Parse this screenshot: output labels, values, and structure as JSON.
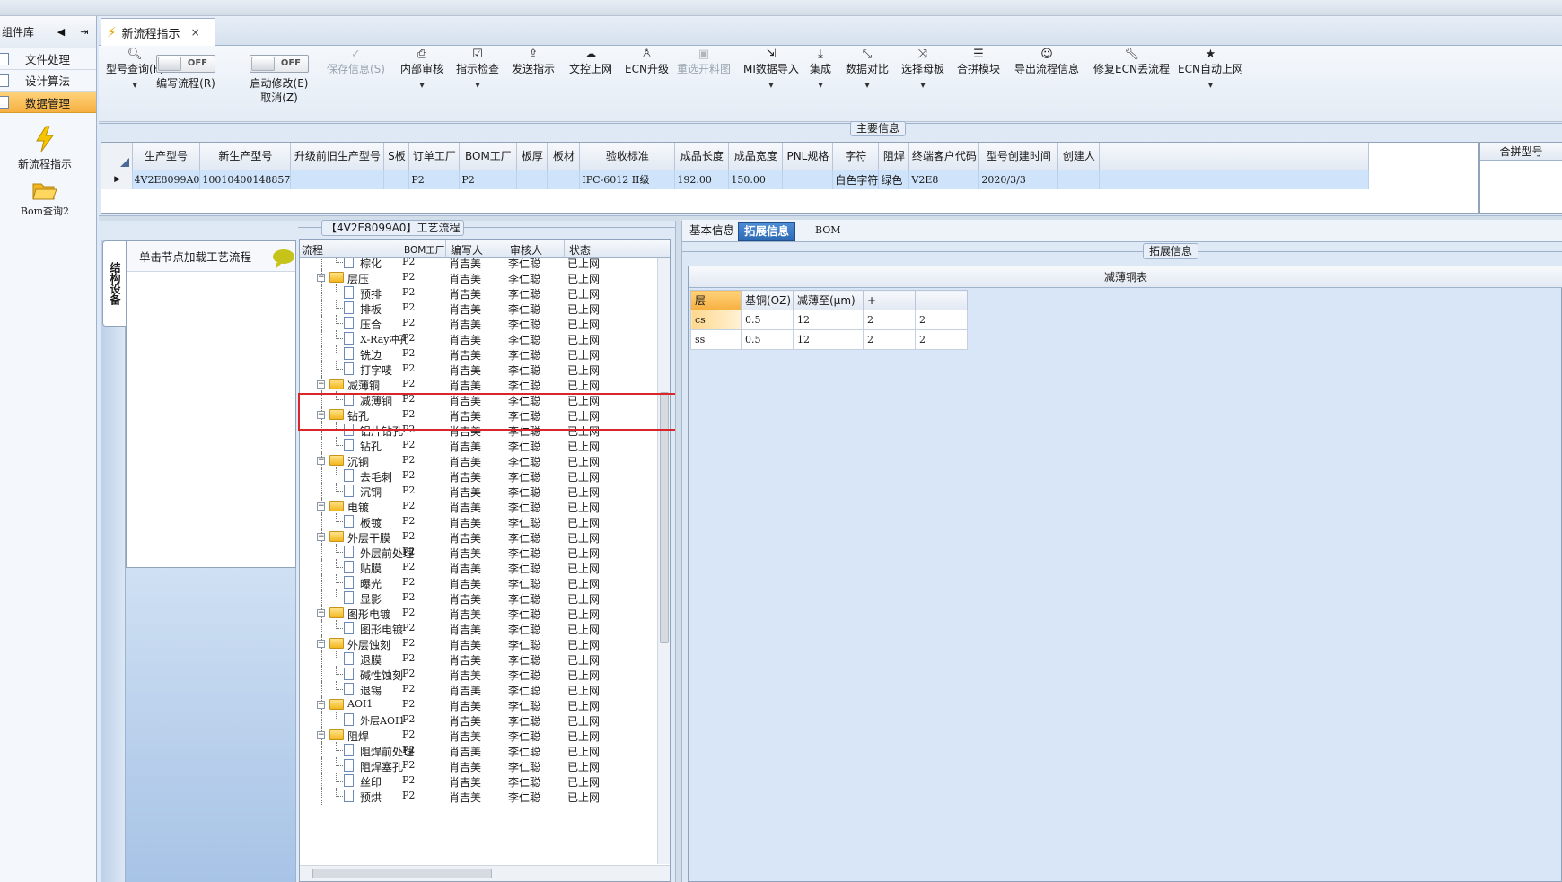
{
  "left_panel": {
    "title": "组件库",
    "items": [
      {
        "label": "文件处理",
        "active": false
      },
      {
        "label": "设计算法",
        "active": false
      },
      {
        "label": "数据管理",
        "active": true
      }
    ],
    "tools": [
      {
        "label": "新流程指示",
        "icon": "lightning-icon"
      },
      {
        "label": "Bom查询2",
        "icon": "folder-open-icon"
      }
    ]
  },
  "doc_tab": {
    "label": "新流程指示",
    "close": "×"
  },
  "toolbar": {
    "query": "型号查询(F)",
    "edit_flow": "编写流程(R)",
    "edit_flow_toggle": "OFF",
    "start_edit": "启动修改(E)",
    "cancel": "取消(Z)",
    "start_edit_toggle": "OFF",
    "save": "保存信息(S)",
    "internal_review": "内部审核",
    "check": "指示检查",
    "send": "发送指示",
    "upload": "文控上网",
    "ecn_upgrade": "ECN升级",
    "reselect_chart": "重选开料图",
    "mi_import": "MI数据导入",
    "integrate": "集成",
    "compare": "数据对比",
    "select_mother": "选择母板",
    "merge_module": "合拼模块",
    "export_flow": "导出流程信息",
    "repair_ecn": "修复ECN丢流程",
    "ecn_auto": "ECN自动上网"
  },
  "main_info": {
    "caption": "主要信息",
    "columns": [
      "生产型号",
      "新生产型号",
      "升级前旧生产型号",
      "S板",
      "订单工厂",
      "BOM工厂",
      "板厚",
      "板材",
      "验收标准",
      "成品长度",
      "成品宽度",
      "PNL规格",
      "字符",
      "阻焊",
      "终端客户代码",
      "型号创建时间",
      "创建人"
    ],
    "row": [
      "4V2E8099A0",
      "10010400148857",
      "",
      "",
      "P2",
      "P2",
      "",
      "",
      "IPC-6012 II级",
      "192.00",
      "150.00",
      "",
      "白色字符",
      "绿色",
      "V2E8",
      "2020/3/3",
      ""
    ],
    "right_header": "合拼型号"
  },
  "structure": {
    "vtab": "结构设备",
    "hint": "单击节点加载工艺流程"
  },
  "process_flow": {
    "caption": "【4V2E8099A0】工艺流程",
    "columns": [
      "流程",
      "BOM工厂",
      "编写人",
      "审核人",
      "状态"
    ],
    "rows": [
      {
        "name": "棕化",
        "level": 1,
        "type": "doc",
        "bom": "P2",
        "writer": "肖吉美",
        "reviewer": "李仁聪",
        "status": "已上网"
      },
      {
        "name": "层压",
        "level": 0,
        "type": "folder",
        "bom": "P2",
        "writer": "肖吉美",
        "reviewer": "李仁聪",
        "status": "已上网"
      },
      {
        "name": "预排",
        "level": 1,
        "type": "doc",
        "bom": "P2",
        "writer": "肖吉美",
        "reviewer": "李仁聪",
        "status": "已上网"
      },
      {
        "name": "排板",
        "level": 1,
        "type": "doc",
        "bom": "P2",
        "writer": "肖吉美",
        "reviewer": "李仁聪",
        "status": "已上网"
      },
      {
        "name": "压合",
        "level": 1,
        "type": "doc",
        "bom": "P2",
        "writer": "肖吉美",
        "reviewer": "李仁聪",
        "status": "已上网"
      },
      {
        "name": "X-Ray冲孔",
        "level": 1,
        "type": "doc",
        "bom": "P2",
        "writer": "肖吉美",
        "reviewer": "李仁聪",
        "status": "已上网"
      },
      {
        "name": "铣边",
        "level": 1,
        "type": "doc",
        "bom": "P2",
        "writer": "肖吉美",
        "reviewer": "李仁聪",
        "status": "已上网"
      },
      {
        "name": "打字唛",
        "level": 1,
        "type": "doc",
        "bom": "P2",
        "writer": "肖吉美",
        "reviewer": "李仁聪",
        "status": "已上网"
      },
      {
        "name": "减薄铜",
        "level": 0,
        "type": "folder",
        "bom": "P2",
        "writer": "肖吉美",
        "reviewer": "李仁聪",
        "status": "已上网"
      },
      {
        "name": "减薄铜",
        "level": 1,
        "type": "doc",
        "bom": "P2",
        "writer": "肖吉美",
        "reviewer": "李仁聪",
        "status": "已上网"
      },
      {
        "name": "钻孔",
        "level": 0,
        "type": "folder",
        "bom": "P2",
        "writer": "肖吉美",
        "reviewer": "李仁聪",
        "status": "已上网"
      },
      {
        "name": "铝片钻孔",
        "level": 1,
        "type": "doc",
        "bom": "P2",
        "writer": "肖吉美",
        "reviewer": "李仁聪",
        "status": "已上网"
      },
      {
        "name": "钻孔",
        "level": 1,
        "type": "doc",
        "bom": "P2",
        "writer": "肖吉美",
        "reviewer": "李仁聪",
        "status": "已上网"
      },
      {
        "name": "沉铜",
        "level": 0,
        "type": "folder",
        "bom": "P2",
        "writer": "肖吉美",
        "reviewer": "李仁聪",
        "status": "已上网"
      },
      {
        "name": "去毛刺",
        "level": 1,
        "type": "doc",
        "bom": "P2",
        "writer": "肖吉美",
        "reviewer": "李仁聪",
        "status": "已上网"
      },
      {
        "name": "沉铜",
        "level": 1,
        "type": "doc",
        "bom": "P2",
        "writer": "肖吉美",
        "reviewer": "李仁聪",
        "status": "已上网"
      },
      {
        "name": "电镀",
        "level": 0,
        "type": "folder",
        "bom": "P2",
        "writer": "肖吉美",
        "reviewer": "李仁聪",
        "status": "已上网"
      },
      {
        "name": "板镀",
        "level": 1,
        "type": "doc",
        "bom": "P2",
        "writer": "肖吉美",
        "reviewer": "李仁聪",
        "status": "已上网"
      },
      {
        "name": "外层干膜",
        "level": 0,
        "type": "folder",
        "bom": "P2",
        "writer": "肖吉美",
        "reviewer": "李仁聪",
        "status": "已上网"
      },
      {
        "name": "外层前处理",
        "level": 1,
        "type": "doc",
        "bom": "P2",
        "writer": "肖吉美",
        "reviewer": "李仁聪",
        "status": "已上网"
      },
      {
        "name": "贴膜",
        "level": 1,
        "type": "doc",
        "bom": "P2",
        "writer": "肖吉美",
        "reviewer": "李仁聪",
        "status": "已上网"
      },
      {
        "name": "曝光",
        "level": 1,
        "type": "doc",
        "bom": "P2",
        "writer": "肖吉美",
        "reviewer": "李仁聪",
        "status": "已上网"
      },
      {
        "name": "显影",
        "level": 1,
        "type": "doc",
        "bom": "P2",
        "writer": "肖吉美",
        "reviewer": "李仁聪",
        "status": "已上网"
      },
      {
        "name": "图形电镀",
        "level": 0,
        "type": "folder",
        "bom": "P2",
        "writer": "肖吉美",
        "reviewer": "李仁聪",
        "status": "已上网"
      },
      {
        "name": "图形电镀",
        "level": 1,
        "type": "doc",
        "bom": "P2",
        "writer": "肖吉美",
        "reviewer": "李仁聪",
        "status": "已上网"
      },
      {
        "name": "外层蚀刻",
        "level": 0,
        "type": "folder",
        "bom": "P2",
        "writer": "肖吉美",
        "reviewer": "李仁聪",
        "status": "已上网"
      },
      {
        "name": "退膜",
        "level": 1,
        "type": "doc",
        "bom": "P2",
        "writer": "肖吉美",
        "reviewer": "李仁聪",
        "status": "已上网"
      },
      {
        "name": "碱性蚀刻",
        "level": 1,
        "type": "doc",
        "bom": "P2",
        "writer": "肖吉美",
        "reviewer": "李仁聪",
        "status": "已上网"
      },
      {
        "name": "退锡",
        "level": 1,
        "type": "doc",
        "bom": "P2",
        "writer": "肖吉美",
        "reviewer": "李仁聪",
        "status": "已上网"
      },
      {
        "name": "AOI1",
        "level": 0,
        "type": "folder",
        "bom": "P2",
        "writer": "肖吉美",
        "reviewer": "李仁聪",
        "status": "已上网"
      },
      {
        "name": "外层AOI1",
        "level": 1,
        "type": "doc",
        "bom": "P2",
        "writer": "肖吉美",
        "reviewer": "李仁聪",
        "status": "已上网"
      },
      {
        "name": "阻焊",
        "level": 0,
        "type": "folder",
        "bom": "P2",
        "writer": "肖吉美",
        "reviewer": "李仁聪",
        "status": "已上网"
      },
      {
        "name": "阻焊前处理",
        "level": 1,
        "type": "doc",
        "bom": "P2",
        "writer": "肖吉美",
        "reviewer": "李仁聪",
        "status": "已上网"
      },
      {
        "name": "阻焊塞孔",
        "level": 1,
        "type": "doc",
        "bom": "P2",
        "writer": "肖吉美",
        "reviewer": "李仁聪",
        "status": "已上网"
      },
      {
        "name": "丝印",
        "level": 1,
        "type": "doc",
        "bom": "P2",
        "writer": "肖吉美",
        "reviewer": "李仁聪",
        "status": "已上网"
      },
      {
        "name": "预烘",
        "level": 1,
        "type": "doc",
        "bom": "P2",
        "writer": "肖吉美",
        "reviewer": "李仁聪",
        "status": "已上网"
      }
    ]
  },
  "detail": {
    "tabs": [
      {
        "label": "基本信息",
        "active": false
      },
      {
        "label": "拓展信息",
        "active": true
      },
      {
        "label": "BOM",
        "active": false
      }
    ],
    "ext_caption": "拓展信息",
    "table_title": "减薄铜表",
    "columns": [
      "层",
      "基铜(OZ)",
      "减薄至(μm)",
      "+",
      "-"
    ],
    "rows": [
      [
        "cs",
        "0.5",
        "12",
        "2",
        "2"
      ],
      [
        "ss",
        "0.5",
        "12",
        "2",
        "2"
      ]
    ]
  }
}
